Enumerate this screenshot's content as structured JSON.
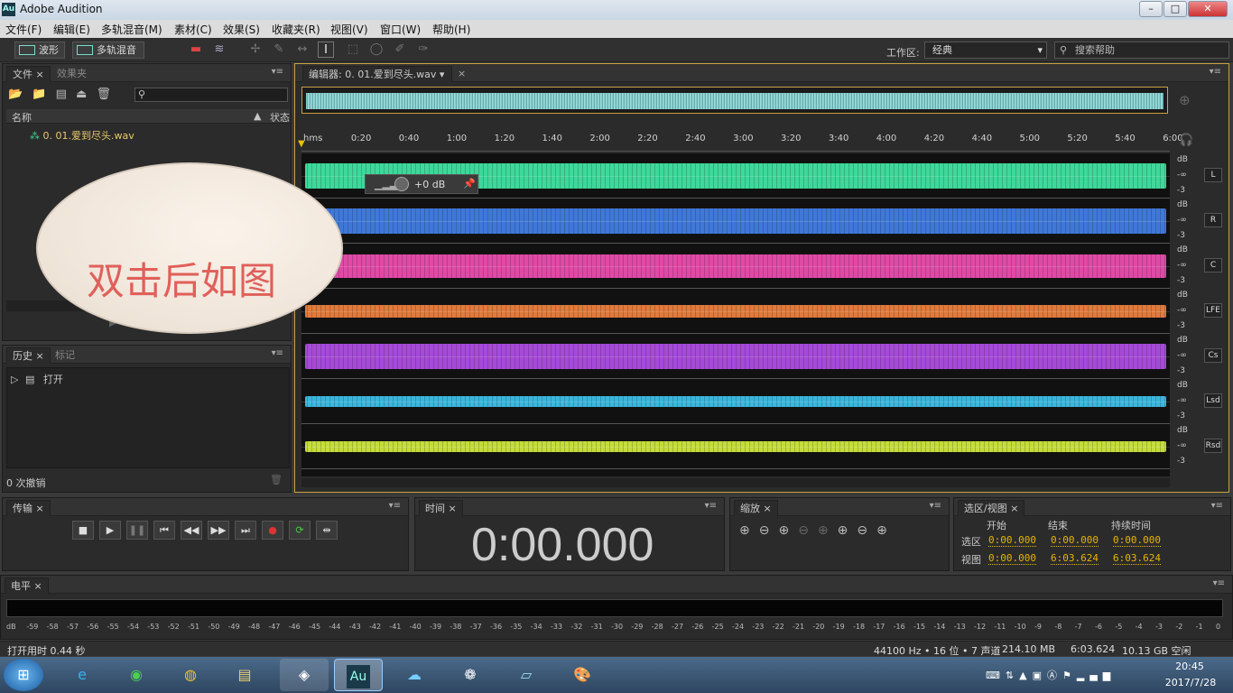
{
  "window": {
    "title": "Adobe Audition",
    "logo": "Au"
  },
  "menu": [
    "文件(F)",
    "编辑(E)",
    "多轨混音(M)",
    "素材(C)",
    "效果(S)",
    "收藏夹(R)",
    "视图(V)",
    "窗口(W)",
    "帮助(H)"
  ],
  "toolbar": {
    "waveform_label": "波形",
    "multitrack_label": "多轨混音",
    "workspace_label": "工作区:",
    "workspace_value": "经典",
    "search_placeholder": "搜索帮助"
  },
  "files_panel": {
    "tab_files": "文件",
    "tab_effects": "效果夹",
    "col_name": "名称",
    "col_status": "状态",
    "file_name": "0. 01.爱到尽头.wav"
  },
  "history_panel": {
    "tab_history": "历史",
    "tab_markers": "标记",
    "item": "打开",
    "undo_count": "0 次撤销"
  },
  "editor": {
    "tab_label": "编辑器: 0. 01.爱到尽头.wav",
    "hud_gain": "+0 dB",
    "time_ticks": [
      "hms",
      "0:20",
      "0:40",
      "1:00",
      "1:20",
      "1:40",
      "2:00",
      "2:20",
      "2:40",
      "3:00",
      "3:20",
      "3:40",
      "4:00",
      "4:20",
      "4:40",
      "5:00",
      "5:20",
      "5:40",
      "6:00"
    ],
    "channels": [
      {
        "name": "L",
        "color": "#3ed89a"
      },
      {
        "name": "R",
        "color": "#3f78d8"
      },
      {
        "name": "C",
        "color": "#e04aa6"
      },
      {
        "name": "LFE",
        "color": "#e07a3c"
      },
      {
        "name": "Cs",
        "color": "#a64ad8"
      },
      {
        "name": "Lsd",
        "color": "#3ab6dc"
      },
      {
        "name": "Rsd",
        "color": "#c4dc3a"
      }
    ],
    "db_labels": {
      "top": "dB",
      "mid": "-∞",
      "bottom": "-3"
    }
  },
  "annotation": {
    "text": "双击后如图"
  },
  "transport": {
    "tab": "传输"
  },
  "time": {
    "tab": "时间",
    "value": "0:00.000"
  },
  "zoom": {
    "tab": "缩放"
  },
  "selection": {
    "tab": "选区/视图",
    "col_start": "开始",
    "col_end": "结束",
    "col_duration": "持续时间",
    "row_selection": "选区",
    "row_view": "视图",
    "sel_start": "0:00.000",
    "sel_end": "0:00.000",
    "sel_dur": "0:00.000",
    "view_start": "0:00.000",
    "view_end": "6:03.624",
    "view_dur": "6:03.624"
  },
  "meter": {
    "tab": "电平",
    "scale": [
      "dB",
      "-59",
      "-58",
      "-57",
      "-56",
      "-55",
      "-54",
      "-53",
      "-52",
      "-51",
      "-50",
      "-49",
      "-48",
      "-47",
      "-46",
      "-45",
      "-44",
      "-43",
      "-42",
      "-41",
      "-40",
      "-39",
      "-38",
      "-37",
      "-36",
      "-35",
      "-34",
      "-33",
      "-32",
      "-31",
      "-30",
      "-29",
      "-28",
      "-27",
      "-26",
      "-25",
      "-24",
      "-23",
      "-22",
      "-21",
      "-20",
      "-19",
      "-18",
      "-17",
      "-16",
      "-15",
      "-14",
      "-13",
      "-12",
      "-11",
      "-10",
      "-9",
      "-8",
      "-7",
      "-6",
      "-5",
      "-4",
      "-3",
      "-2",
      "-1",
      "0"
    ]
  },
  "status": {
    "left": "打开用时 0.44 秒",
    "format": "44100 Hz • 16 位 • 7 声道",
    "size": "214.10 MB",
    "duration": "6:03.624",
    "free": "10.13 GB 空闲"
  },
  "taskbar": {
    "time": "20:45",
    "date": "2017/7/28"
  }
}
